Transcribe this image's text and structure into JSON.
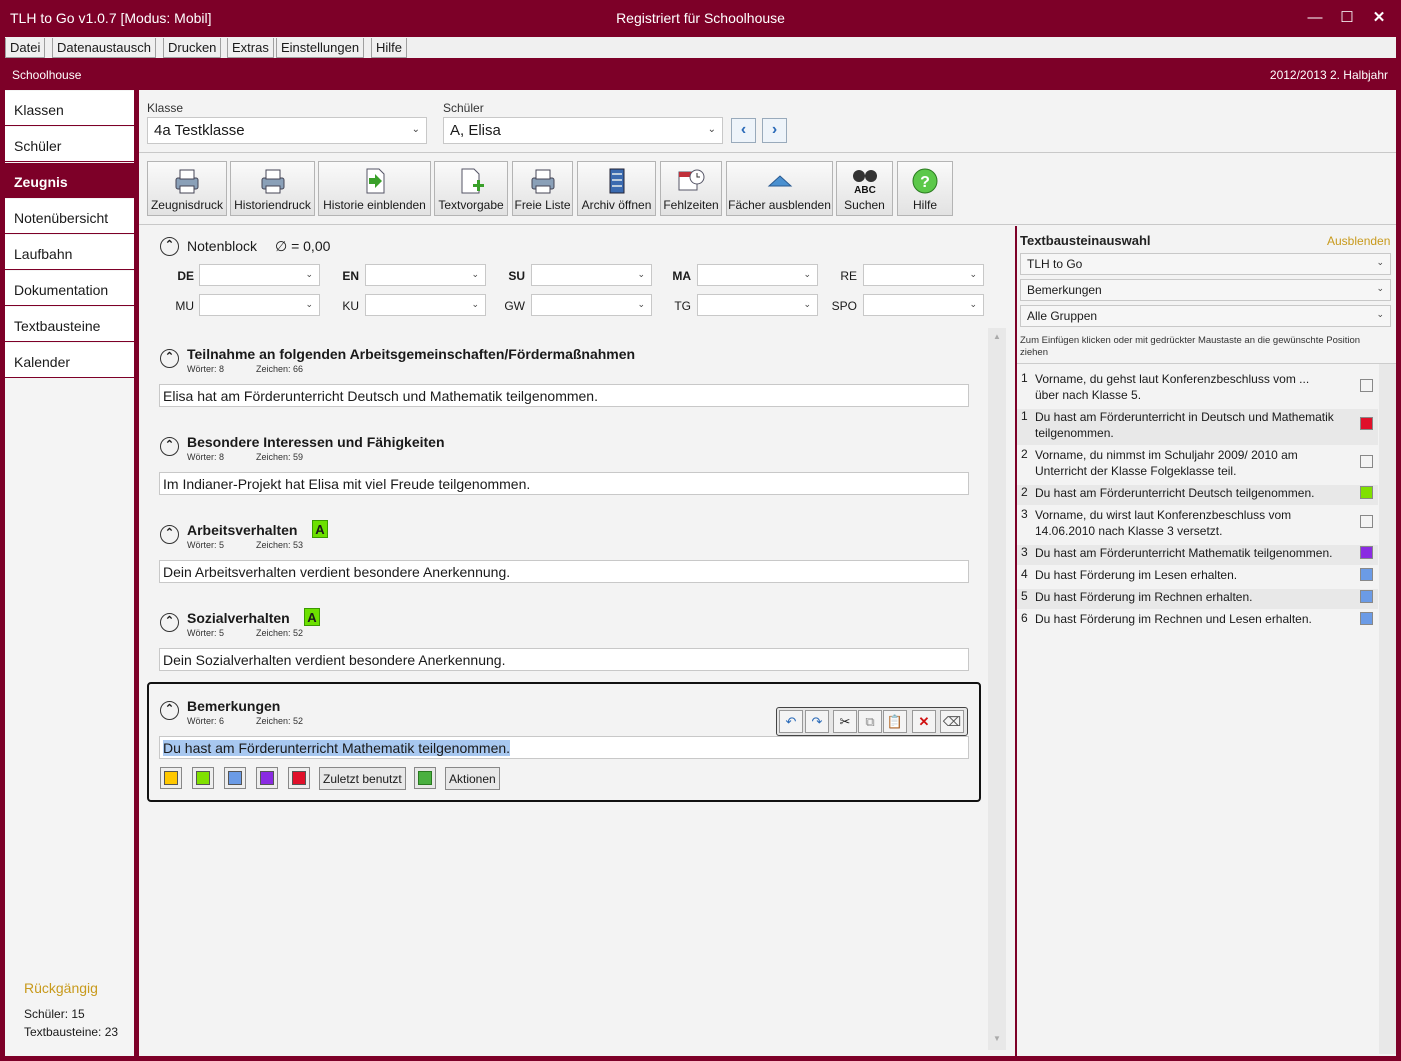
{
  "window": {
    "title": "TLH to Go v1.0.7 [Modus: Mobil]",
    "center": "Registriert für Schoolhouse"
  },
  "menu": [
    "Datei",
    "Datenaustausch",
    "Drucken",
    "Extras",
    "Einstellungen",
    "Hilfe"
  ],
  "school": {
    "name": "Schoolhouse",
    "period": "2012/2013 2. Halbjahr"
  },
  "sidebar": {
    "items": [
      "Klassen",
      "Schüler",
      "Zeugnis",
      "Notenübersicht",
      "Laufbahn",
      "Dokumentation",
      "Textbausteine",
      "Kalender"
    ],
    "undo": "Rückgängig",
    "stat_students": "Schüler: 15",
    "stat_blocks": "Textbausteine: 23"
  },
  "selectors": {
    "class_label": "Klasse",
    "class_value": "4a Testklasse",
    "student_label": "Schüler",
    "student_value": "A, Elisa"
  },
  "toolbar": [
    "Zeugnisdruck",
    "Historiendruck",
    "Historie einblenden",
    "Textvorgabe",
    "Freie Liste",
    "Archiv öffnen",
    "Fehlzeiten",
    "Fächer ausblenden",
    "Suchen",
    "Hilfe"
  ],
  "grades": {
    "title": "Notenblock",
    "avg": "∅ = 0,00",
    "row1": [
      "DE",
      "EN",
      "SU",
      "MA",
      "RE"
    ],
    "row2": [
      "MU",
      "KU",
      "GW",
      "TG",
      "SPO"
    ]
  },
  "sections": [
    {
      "title": "Teilnahme an folgenden Arbeitsgemeinschaften/Fördermaßnahmen",
      "words": "Wörter: 8",
      "chars": "Zeichen: 66",
      "text": "Elisa hat am Förderunterricht Deutsch und Mathematik teilgenommen.",
      "badge": ""
    },
    {
      "title": "Besondere Interessen und Fähigkeiten",
      "words": "Wörter: 8",
      "chars": "Zeichen: 59",
      "text": "Im Indianer-Projekt hat Elisa mit viel Freude teilgenommen.",
      "badge": ""
    },
    {
      "title": "Arbeitsverhalten",
      "words": "Wörter: 5",
      "chars": "Zeichen: 53",
      "text": "Dein Arbeitsverhalten verdient besondere Anerkennung.",
      "badge": "A"
    },
    {
      "title": "Sozialverhalten",
      "words": "Wörter: 5",
      "chars": "Zeichen: 52",
      "text": "Dein Sozialverhalten verdient besondere Anerkennung.",
      "badge": "A"
    },
    {
      "title": "Bemerkungen",
      "words": "Wörter: 6",
      "chars": "Zeichen: 52",
      "text": "Du hast am Förderunterricht Mathematik teilgenommen.",
      "badge": ""
    }
  ],
  "editor": {
    "recent": "Zuletzt benutzt",
    "actions": "Aktionen",
    "colors": [
      "#ffc800",
      "#80e000",
      "#6b9be6",
      "#8a2be2",
      "#e0102a"
    ]
  },
  "right": {
    "title": "Textbausteinauswahl",
    "hide": "Ausblenden",
    "combo1": "TLH to Go",
    "combo2": "Bemerkungen",
    "combo3": "Alle Gruppen",
    "hint": "Zum Einfügen klicken oder mit gedrückter Maustaste an die gewünschte Position ziehen",
    "items": [
      {
        "n": "1",
        "t": "Vorname, du gehst laut Konferenzbeschluss vom ... über nach Klasse 5.",
        "c": "#f4f4f4"
      },
      {
        "n": "1",
        "t": "Du hast am Förderunterricht in Deutsch und Mathematik teilgenommen.",
        "c": "#e0102a"
      },
      {
        "n": "2",
        "t": "Vorname, du nimmst im Schuljahr 2009/ 2010 am Unterricht der Klasse Folgeklasse teil.",
        "c": "#f4f4f4"
      },
      {
        "n": "2",
        "t": "Du hast am Förderunterricht Deutsch teilgenommen.",
        "c": "#80e000"
      },
      {
        "n": "3",
        "t": "Vorname, du wirst laut Konferenzbeschluss vom 14.06.2010 nach Klasse 3 versetzt.",
        "c": "#f4f4f4"
      },
      {
        "n": "3",
        "t": "Du hast am Förderunterricht Mathematik teilgenommen.",
        "c": "#8a2be2"
      },
      {
        "n": "4",
        "t": "Du hast Förderung im Lesen erhalten.",
        "c": "#6b9be6"
      },
      {
        "n": "5",
        "t": "Du hast Förderung im Rechnen erhalten.",
        "c": "#6b9be6"
      },
      {
        "n": "6",
        "t": "Du hast Förderung im Rechnen und Lesen erhalten.",
        "c": "#6b9be6"
      }
    ]
  }
}
